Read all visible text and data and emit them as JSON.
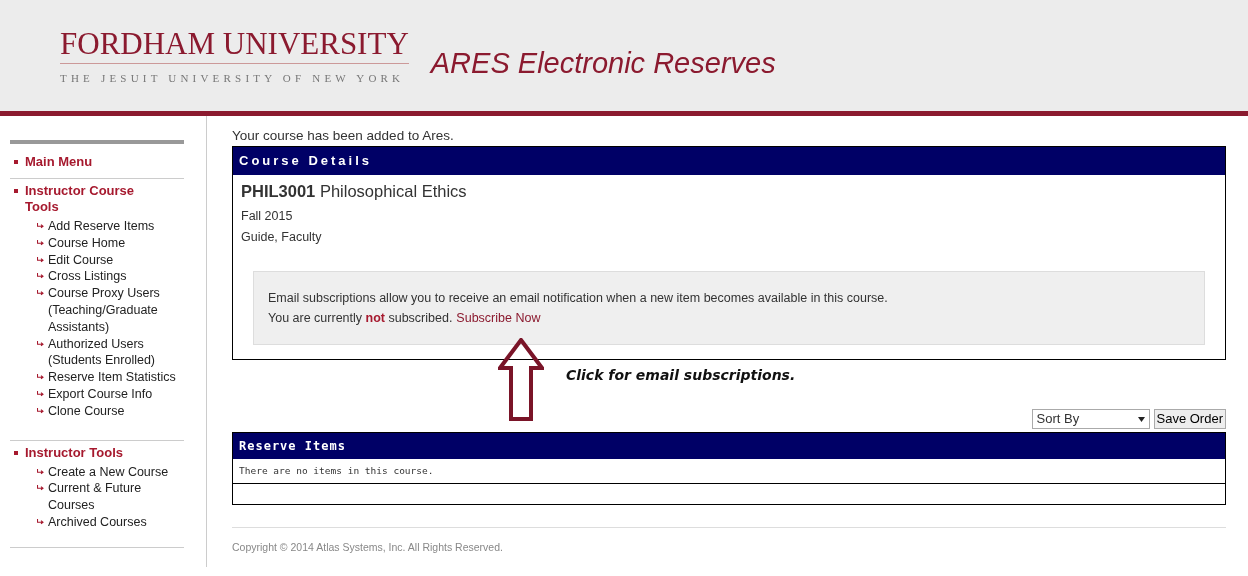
{
  "header": {
    "university": "FORDHAM UNIVERSITY",
    "tagline": "THE JESUIT UNIVERSITY OF NEW YORK",
    "app_title": "ARES Electronic Reserves"
  },
  "sidebar": {
    "sections": [
      {
        "label": "Main Menu"
      },
      {
        "label": "Instructor Course Tools",
        "items": [
          "Add Reserve Items",
          "Course Home",
          "Edit Course",
          "Cross Listings",
          "Course Proxy Users (Teaching/Graduate Assistants)",
          "Authorized Users (Students Enrolled)",
          "Reserve Item Statistics",
          "Export Course Info",
          "Clone Course"
        ]
      },
      {
        "label": "Instructor Tools",
        "items": [
          "Create a New Course",
          "Current & Future Courses",
          "Archived Courses"
        ]
      }
    ]
  },
  "message": "Your course has been added to Ares.",
  "course_details": {
    "heading": "Course Details",
    "code": "PHIL3001",
    "name": "Philosophical Ethics",
    "term": "Fall 2015",
    "instructor": "Guide, Faculty",
    "subscription": {
      "info": "Email subscriptions allow you to receive an email notification when a new item becomes available in this course.",
      "status": "You are currently **not** subscribed.",
      "link": "Subscribe Now"
    }
  },
  "annotation": {
    "text": "Click for email subscriptions."
  },
  "sort": {
    "value": "Sort By",
    "button": "Save Order"
  },
  "reserve_items": {
    "heading": "Reserve Items",
    "empty": "There are no items in this course."
  },
  "footer": "Copyright © 2014 Atlas Systems, Inc. All Rights Reserved."
}
